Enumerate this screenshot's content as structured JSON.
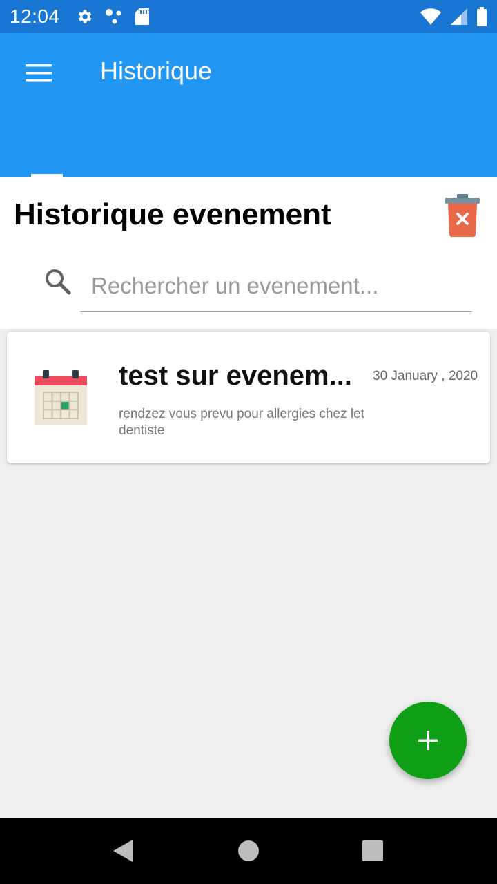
{
  "status_bar": {
    "time": "12:04",
    "icons_left": [
      "gear-icon",
      "share-dots-icon",
      "sd-card-icon"
    ],
    "icons_right": [
      "wifi-icon",
      "signal-icon",
      "battery-icon"
    ]
  },
  "app_bar": {
    "title": "Historique",
    "menu_icon": "hamburger-menu-icon",
    "color": "#2196f3"
  },
  "header": {
    "title": "Historique evenement",
    "delete_icon": "trash-icon"
  },
  "search": {
    "placeholder": "Rechercher un evenement...",
    "value": ""
  },
  "events": [
    {
      "title": "test sur evenem...",
      "date": "30 January , 2020",
      "description": "rendzez vous prevu pour allergies chez let dentiste",
      "icon": "calendar-icon"
    }
  ],
  "fab": {
    "icon": "plus-icon",
    "color": "#0e9f16"
  },
  "nav_bar": {
    "icons": [
      "back-icon",
      "home-icon",
      "recents-icon"
    ]
  }
}
